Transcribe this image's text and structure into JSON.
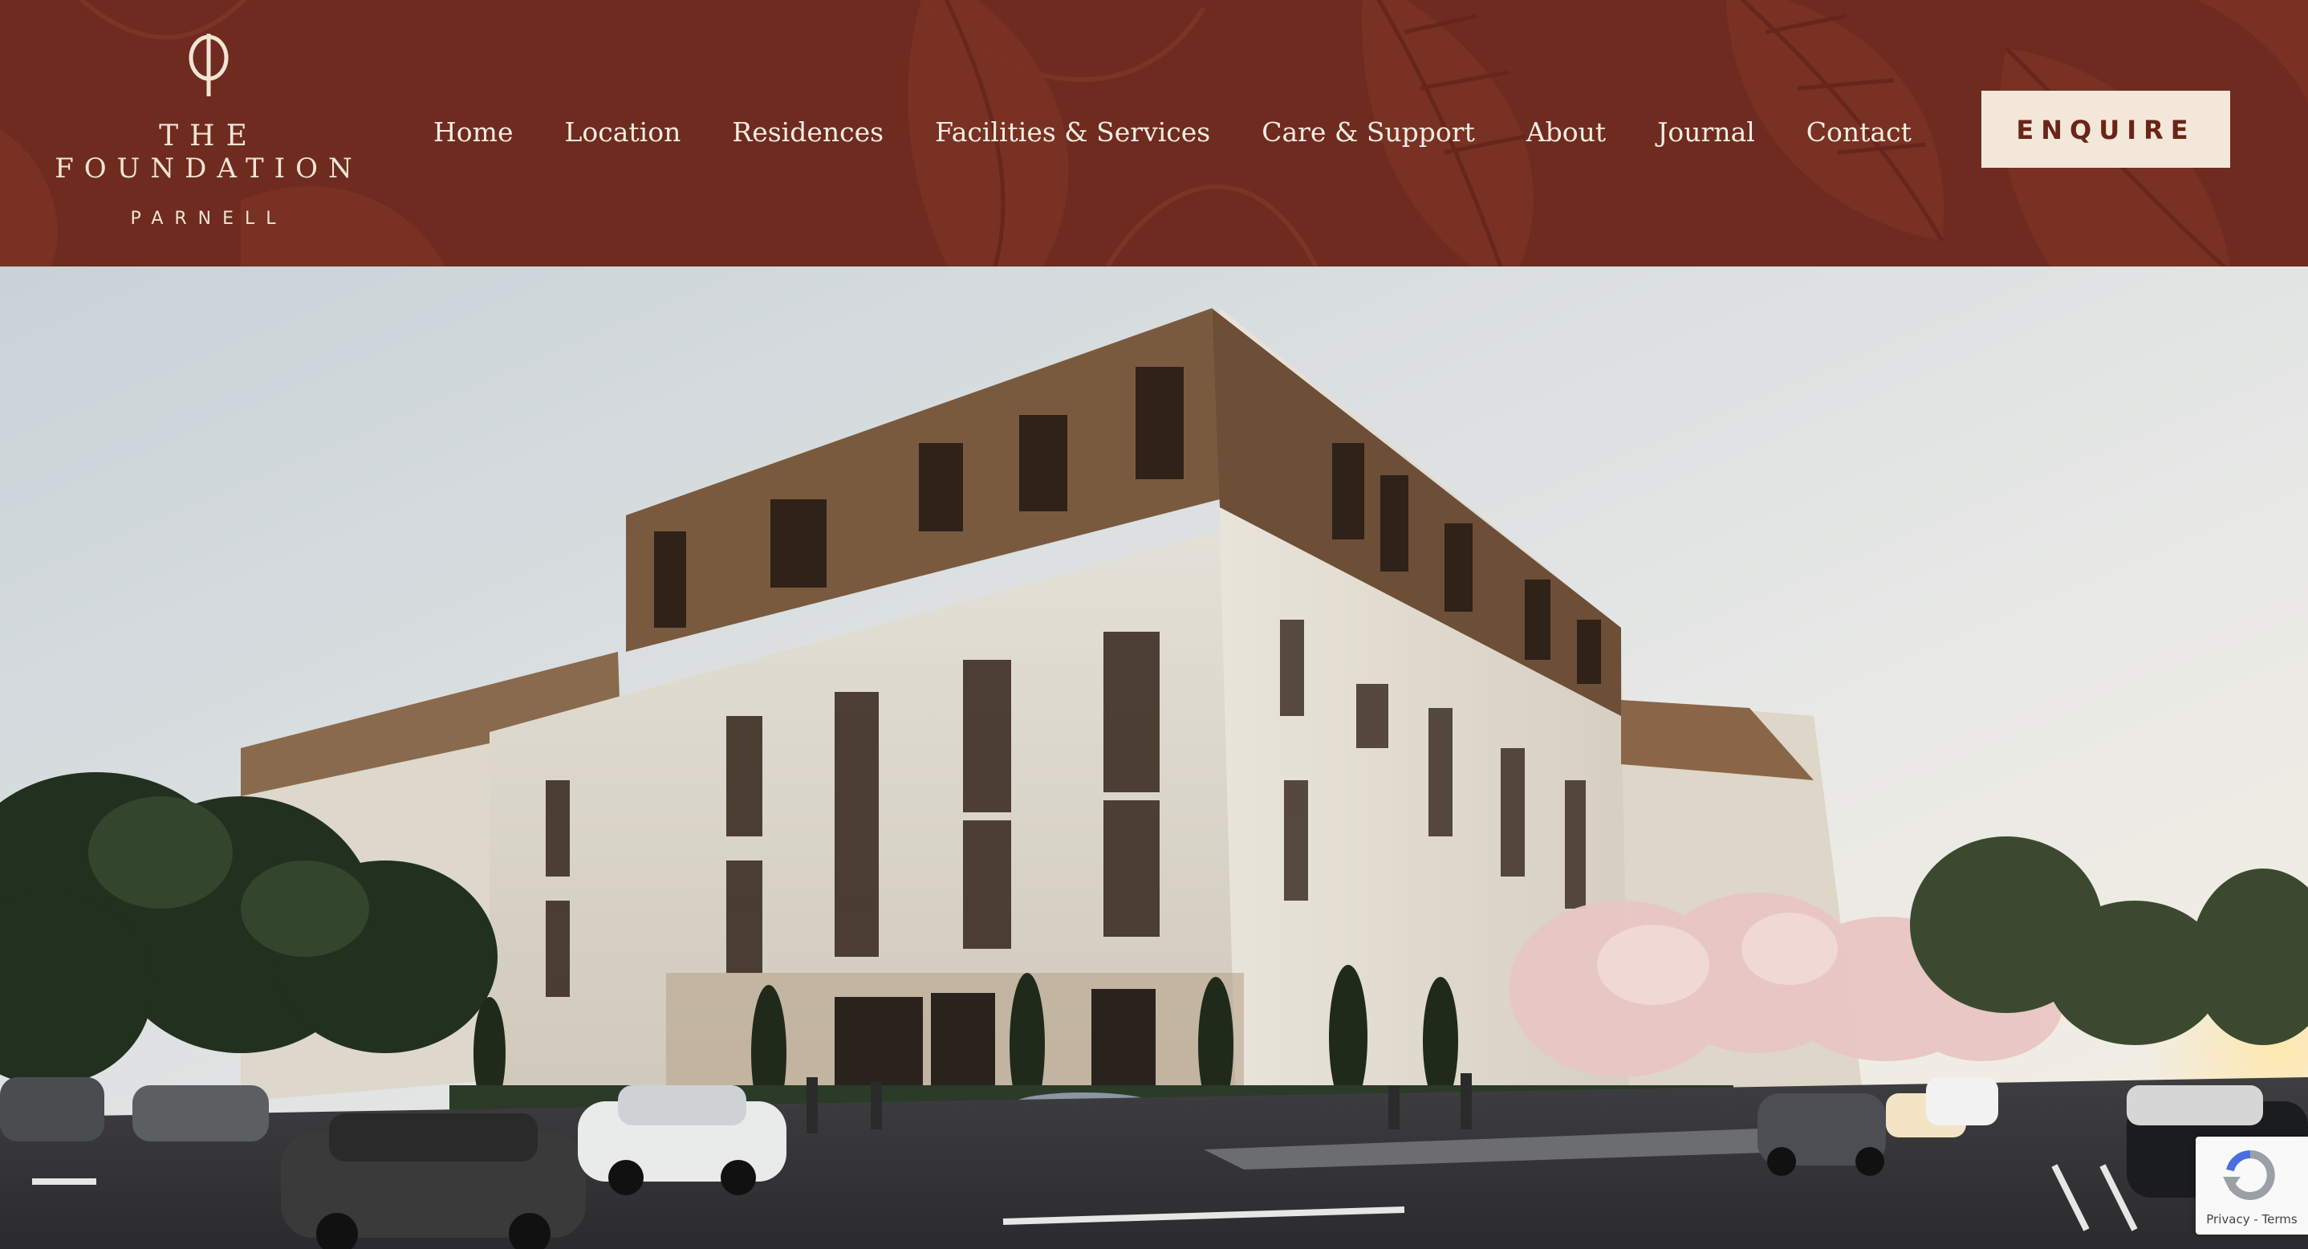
{
  "brand": {
    "line1": "THE",
    "line2": "FOUNDATION",
    "line3": "PARNELL"
  },
  "nav": {
    "items": [
      {
        "label": "Home"
      },
      {
        "label": "Location"
      },
      {
        "label": "Residences"
      },
      {
        "label": "Facilities & Services"
      },
      {
        "label": "Care & Support"
      },
      {
        "label": "About"
      },
      {
        "label": "Journal"
      },
      {
        "label": "Contact"
      }
    ]
  },
  "cta": {
    "label": "ENQUIRE"
  },
  "recaptcha": {
    "privacy": "Privacy",
    "separator": " - ",
    "terms": "Terms"
  },
  "colors": {
    "header_bg": "#6f2b1f",
    "text_light": "#f6ece1",
    "button_bg": "#f3e7da",
    "button_text": "#6a2418"
  },
  "icons": {
    "logo": "leaf-emblem-icon",
    "recaptcha": "recaptcha-icon"
  }
}
